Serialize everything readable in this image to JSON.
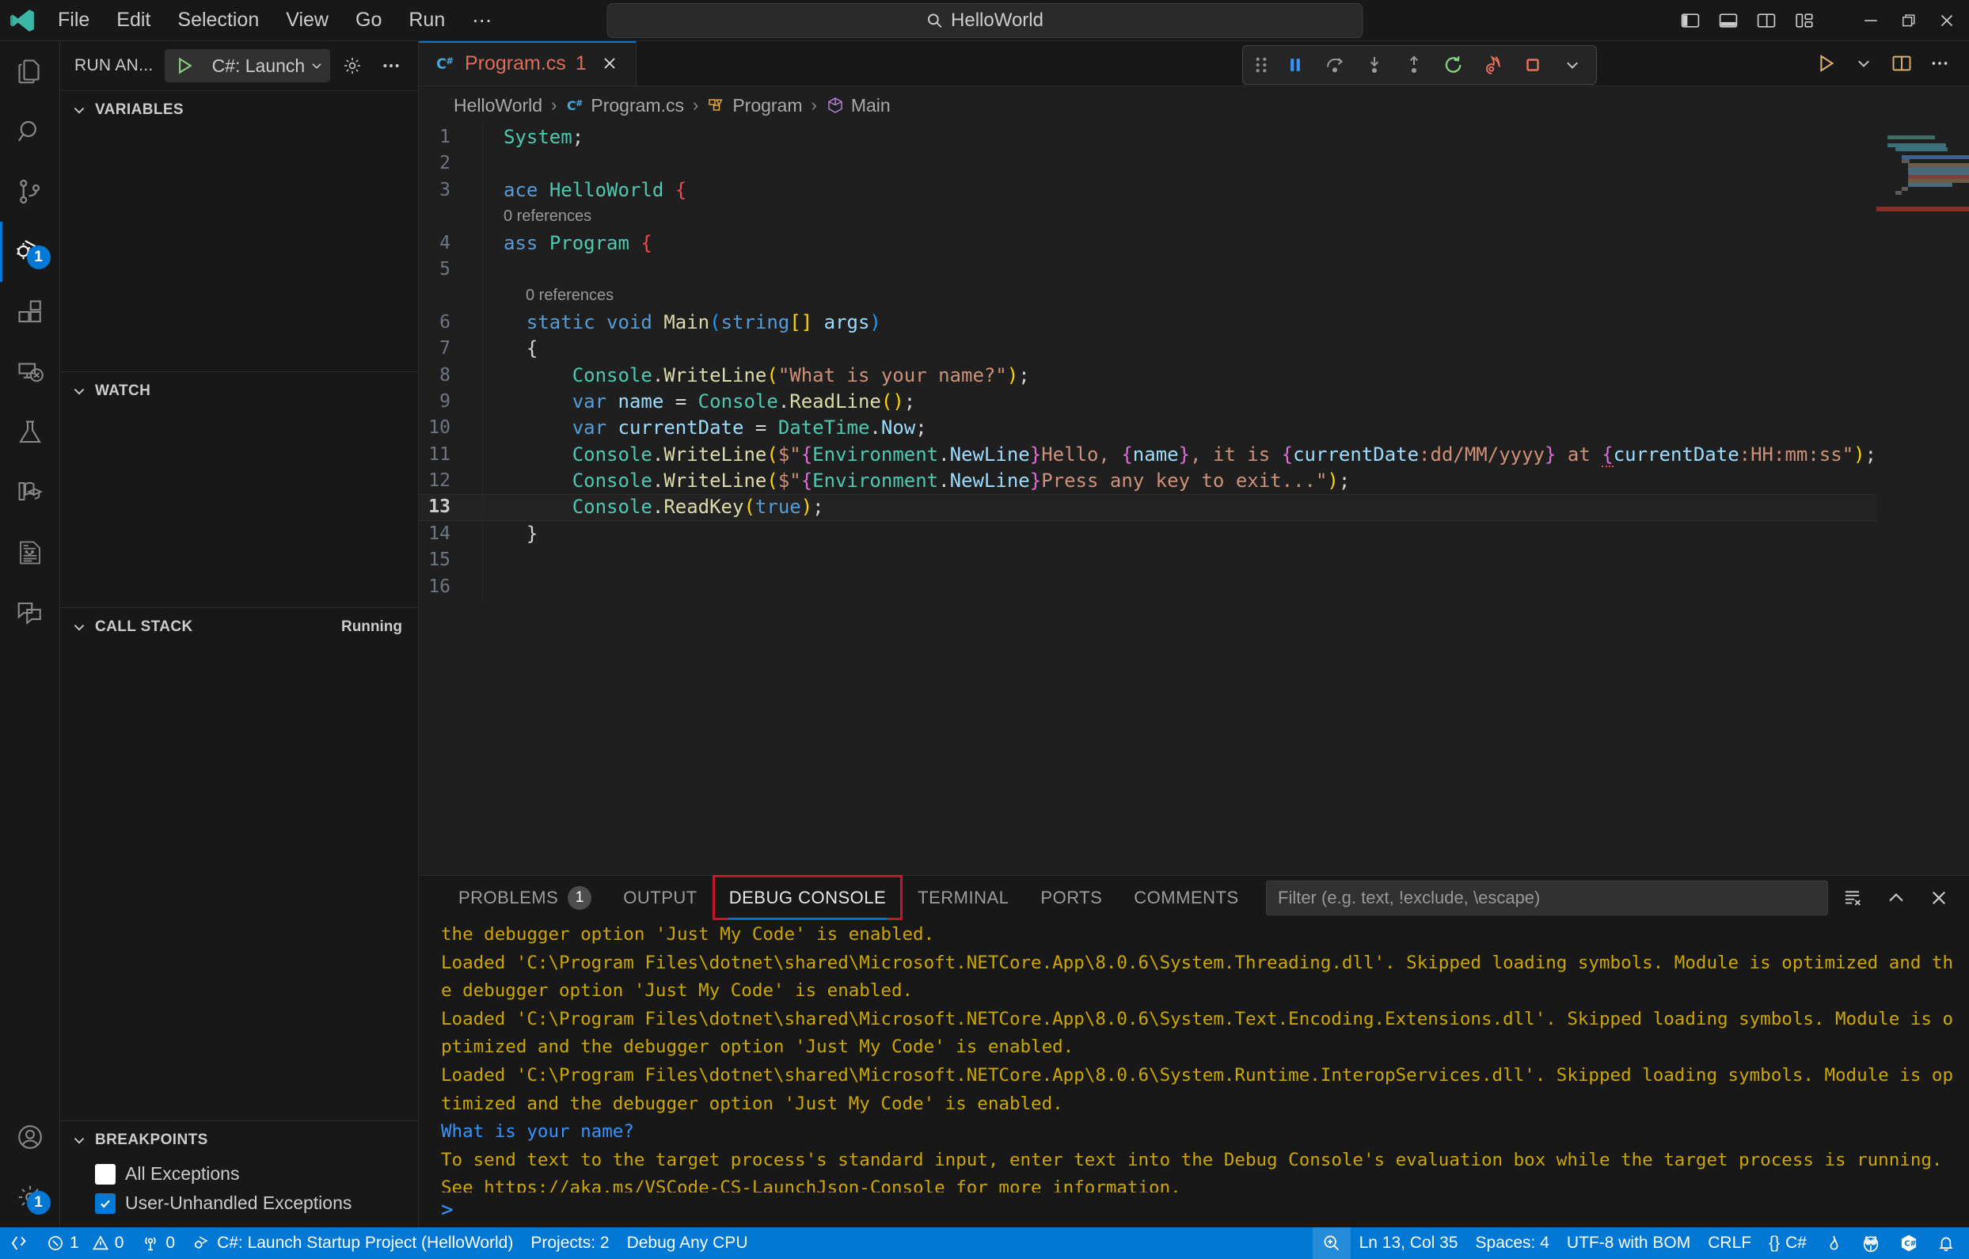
{
  "titlebar": {
    "menu": [
      "File",
      "Edit",
      "Selection",
      "View",
      "Go",
      "Run",
      "⋯"
    ],
    "command_center_text": "HelloWorld",
    "search_icon": "search-icon",
    "layout_buttons": [
      "toggle-primary-sidebar",
      "toggle-panel",
      "toggle-secondary-sidebar",
      "customize-layout"
    ],
    "window_buttons": [
      "minimize",
      "restore",
      "close"
    ]
  },
  "activitybar": {
    "items": [
      {
        "name": "explorer",
        "icon": "files-icon",
        "badge": ""
      },
      {
        "name": "search",
        "icon": "search-icon",
        "badge": ""
      },
      {
        "name": "source-control",
        "icon": "source-control-icon",
        "badge": ""
      },
      {
        "name": "run-and-debug",
        "icon": "debug-alt-icon",
        "badge": "1",
        "active": true
      },
      {
        "name": "extensions",
        "icon": "extensions-icon",
        "badge": ""
      },
      {
        "name": "remote-explorer",
        "icon": "remote-explorer-icon",
        "badge": ""
      },
      {
        "name": "testing",
        "icon": "beaker-icon",
        "badge": ""
      },
      {
        "name": "learn",
        "icon": "book-graduation-icon",
        "badge": ""
      },
      {
        "name": "notebook",
        "icon": "document-icon",
        "badge": ""
      },
      {
        "name": "chat",
        "icon": "comment-discussion-icon",
        "badge": ""
      }
    ],
    "bottom": [
      {
        "name": "accounts",
        "icon": "account-icon",
        "badge": ""
      },
      {
        "name": "settings",
        "icon": "gear-icon",
        "badge": "1"
      }
    ]
  },
  "sidebar": {
    "title": "RUN AN...",
    "launch_config": "C#: Launch",
    "start_icon": "play-icon",
    "gear_icon": "gear-icon",
    "more_icon": "more-actions-icon",
    "sections": [
      {
        "title": "VARIABLES",
        "badge": ""
      },
      {
        "title": "WATCH",
        "badge": ""
      },
      {
        "title": "CALL STACK",
        "badge": "Running"
      },
      {
        "title": "BREAKPOINTS",
        "badge": ""
      }
    ],
    "breakpoints": [
      {
        "label": "All Exceptions",
        "checked": false
      },
      {
        "label": "User-Unhandled Exceptions",
        "checked": true
      }
    ]
  },
  "editor": {
    "tab": {
      "label": "Program.cs",
      "count": "1",
      "icon": "csharp-icon",
      "close_icon": "close-icon"
    },
    "breadcrumb": [
      {
        "label": "HelloWorld",
        "icon": ""
      },
      {
        "label": "Program.cs",
        "icon": "csharp-icon"
      },
      {
        "label": "Program",
        "icon": "class-icon"
      },
      {
        "label": "Main",
        "icon": "method-icon"
      }
    ],
    "debug_toolbar": [
      {
        "name": "drag-handle",
        "icon": "grip-icon"
      },
      {
        "name": "pause",
        "icon": "pause-icon"
      },
      {
        "name": "step-over",
        "icon": "step-over-icon"
      },
      {
        "name": "step-into",
        "icon": "step-into-icon"
      },
      {
        "name": "step-out",
        "icon": "step-out-icon"
      },
      {
        "name": "restart",
        "icon": "restart-icon"
      },
      {
        "name": "hot-reload",
        "icon": "flame-icon"
      },
      {
        "name": "stop",
        "icon": "stop-icon"
      },
      {
        "name": "more",
        "icon": "chevron-down-icon"
      }
    ],
    "actions": [
      {
        "name": "run-or-debug",
        "icon": "play-icon"
      },
      {
        "name": "run-dropdown",
        "icon": "chevron-down-icon"
      },
      {
        "name": "split-editor",
        "icon": "split-editor-icon"
      },
      {
        "name": "more-actions",
        "icon": "more-actions-icon"
      }
    ],
    "codelens": {
      "label": "0 references"
    },
    "lines": [
      {
        "n": "1",
        "text": "System;"
      },
      {
        "n": "2",
        "text": ""
      },
      {
        "n": "3",
        "text": "ace HelloWorld {"
      },
      {
        "n": "4",
        "text": "ass Program {"
      },
      {
        "n": "5",
        "text": ""
      },
      {
        "n": "6",
        "text": "    static void Main(string[] args)"
      },
      {
        "n": "7",
        "text": "    {"
      },
      {
        "n": "8",
        "text": "        Console.WriteLine(\"What is your name?\");"
      },
      {
        "n": "9",
        "text": "        var name = Console.ReadLine();"
      },
      {
        "n": "10",
        "text": "        var currentDate = DateTime.Now;"
      },
      {
        "n": "11",
        "text": "        Console.WriteLine($\"{Environment.NewLine}Hello, {name}, it is {currentDate:dd/MM/yyyy} at {currentDate:HH:mm:ss\");"
      },
      {
        "n": "12",
        "text": "        Console.WriteLine($\"{Environment.NewLine}Press any key to exit...\");"
      },
      {
        "n": "13",
        "text": "        Console.ReadKey(true);"
      },
      {
        "n": "14",
        "text": "    }"
      },
      {
        "n": "15",
        "text": ""
      },
      {
        "n": "16",
        "text": ""
      }
    ],
    "current_line": "13"
  },
  "panel": {
    "tabs": [
      {
        "label": "PROBLEMS",
        "badge": "1",
        "active": false
      },
      {
        "label": "OUTPUT",
        "badge": "",
        "active": false
      },
      {
        "label": "DEBUG CONSOLE",
        "badge": "",
        "active": true,
        "highlighted": true
      },
      {
        "label": "TERMINAL",
        "badge": "",
        "active": false
      },
      {
        "label": "PORTS",
        "badge": "",
        "active": false
      },
      {
        "label": "COMMENTS",
        "badge": "",
        "active": false
      }
    ],
    "filter_placeholder": "Filter (e.g. text, !exclude, \\escape)",
    "filter_value": "",
    "actions": [
      {
        "name": "clear-console",
        "icon": "clear-icon"
      },
      {
        "name": "maximize-panel",
        "icon": "chevron-up-icon"
      },
      {
        "name": "close-panel",
        "icon": "close-icon"
      }
    ],
    "console_lines": [
      {
        "text": "the debugger option 'Just My Code' is enabled.",
        "type": "warn"
      },
      {
        "text": "Loaded 'C:\\Program Files\\dotnet\\shared\\Microsoft.NETCore.App\\8.0.6\\System.Threading.dll'. Skipped loading symbols. Module is optimized and the debugger option 'Just My Code' is enabled.",
        "type": "warn"
      },
      {
        "text": "Loaded 'C:\\Program Files\\dotnet\\shared\\Microsoft.NETCore.App\\8.0.6\\System.Text.Encoding.Extensions.dll'. Skipped loading symbols. Module is optimized and the debugger option 'Just My Code' is enabled.",
        "type": "warn"
      },
      {
        "text": "Loaded 'C:\\Program Files\\dotnet\\shared\\Microsoft.NETCore.App\\8.0.6\\System.Runtime.InteropServices.dll'. Skipped loading symbols. Module is optimized and the debugger option 'Just My Code' is enabled.",
        "type": "warn"
      },
      {
        "text": "What is your name?",
        "type": "info"
      },
      {
        "text": "To send text to the target process's standard input, enter text into the Debug Console's evaluation box while the target process is running. See https://aka.ms/VSCode-CS-LaunchJson-Console for more information.",
        "type": "warn"
      }
    ],
    "input_prompt": ">"
  },
  "statusbar": {
    "remote_icon": "remote-icon",
    "errors": "1",
    "warnings": "0",
    "ports": "0",
    "launch_profile": "C#: Launch Startup Project (HelloWorld)",
    "projects": "Projects: 2",
    "configuration": "Debug Any CPU",
    "zoom_icon": "zoom-icon",
    "cursor_position": "Ln 13, Col 35",
    "indentation": "Spaces: 4",
    "encoding": "UTF-8 with BOM",
    "eol": "CRLF",
    "language": "C#",
    "language_icon": "braces-icon",
    "right_icons": [
      "flame-icon",
      "owl-icon",
      "csharp-badge-icon",
      "bell-icon"
    ]
  },
  "colors": {
    "accent": "#0078d4",
    "error": "#f14c4c",
    "warning": "#cca700",
    "highlight_box": "#c5162c",
    "tab_modified": "#e06c5a"
  }
}
